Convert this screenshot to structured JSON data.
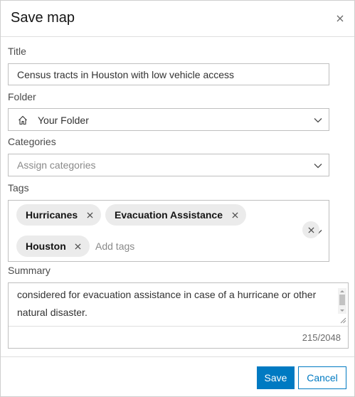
{
  "dialog": {
    "title": "Save map"
  },
  "title_field": {
    "label": "Title",
    "value": "Census tracts in Houston with low vehicle access"
  },
  "folder_field": {
    "label": "Folder",
    "value": "Your Folder",
    "icon": "home-icon"
  },
  "categories_field": {
    "label": "Categories",
    "placeholder": "Assign categories"
  },
  "tags_field": {
    "label": "Tags",
    "tags": [
      "Hurricanes",
      "Evacuation Assistance",
      "Houston"
    ],
    "placeholder": "Add tags"
  },
  "summary_field": {
    "label": "Summary",
    "value": "considered for evacuation assistance in case of a hurricane or other natural disaster.",
    "char_count": "215/2048"
  },
  "footer": {
    "save_label": "Save",
    "cancel_label": "Cancel"
  },
  "colors": {
    "accent": "#007ac2",
    "chip_bg": "#ebebeb",
    "border": "#bfbfbf"
  }
}
